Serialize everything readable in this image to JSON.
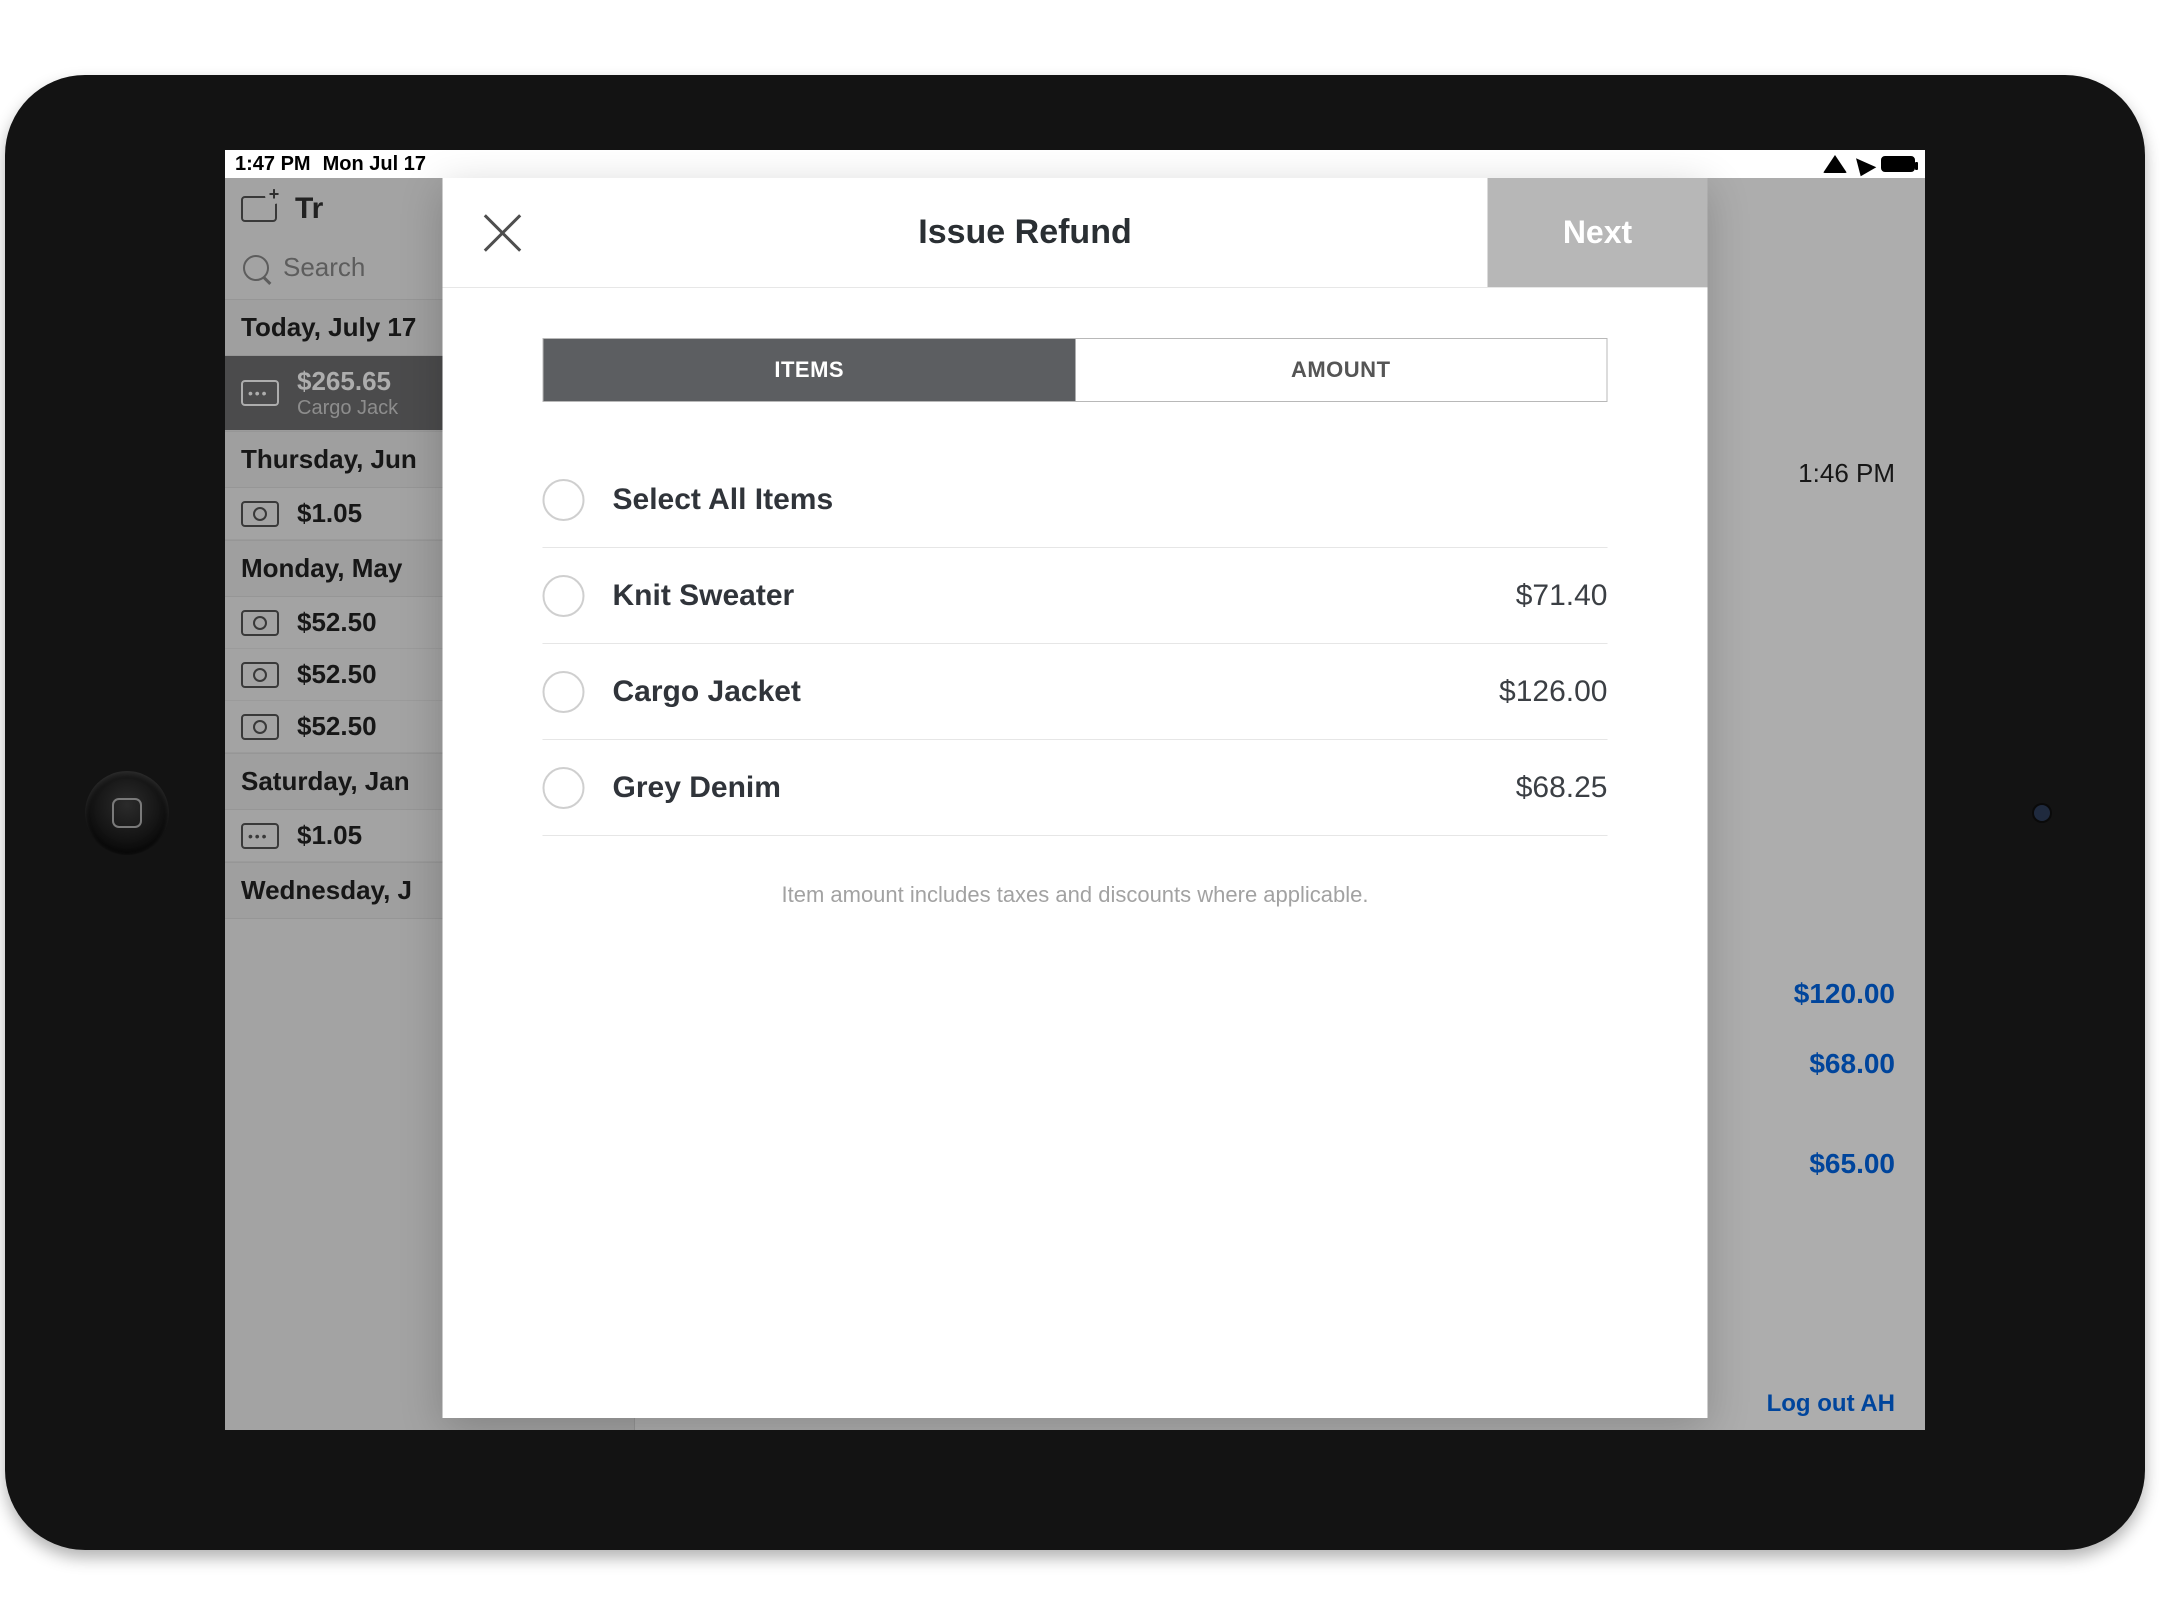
{
  "status": {
    "time": "1:47 PM",
    "date": "Mon Jul 17"
  },
  "sidebar": {
    "title": "Tr",
    "search_placeholder": "Search",
    "sections": [
      {
        "header": "Today, July 17"
      },
      {
        "header": "Thursday, Jun"
      },
      {
        "header": "Monday, May"
      },
      {
        "header": "Saturday, Jan"
      },
      {
        "header": "Wednesday, J"
      }
    ],
    "rows": {
      "r0_amount": "$265.65",
      "r0_sub": "Cargo Jack",
      "r1_amount": "$1.05",
      "r2_amount": "$52.50",
      "r3_amount": "$52.50",
      "r4_amount": "$52.50",
      "r5_amount": "$1.05"
    }
  },
  "detail": {
    "time": "1:46 PM",
    "price1": "$120.00",
    "price2": "$68.00",
    "price3": "$65.00",
    "logout": "Log out AH"
  },
  "modal": {
    "title": "Issue Refund",
    "next": "Next",
    "tabs": {
      "items": "ITEMS",
      "amount": "AMOUNT"
    },
    "rows": {
      "select_all": "Select All Items",
      "item1_label": "Knit Sweater",
      "item1_price": "$71.40",
      "item2_label": "Cargo Jacket",
      "item2_price": "$126.00",
      "item3_label": "Grey Denim",
      "item3_price": "$68.25"
    },
    "note": "Item amount includes taxes and discounts where applicable."
  }
}
